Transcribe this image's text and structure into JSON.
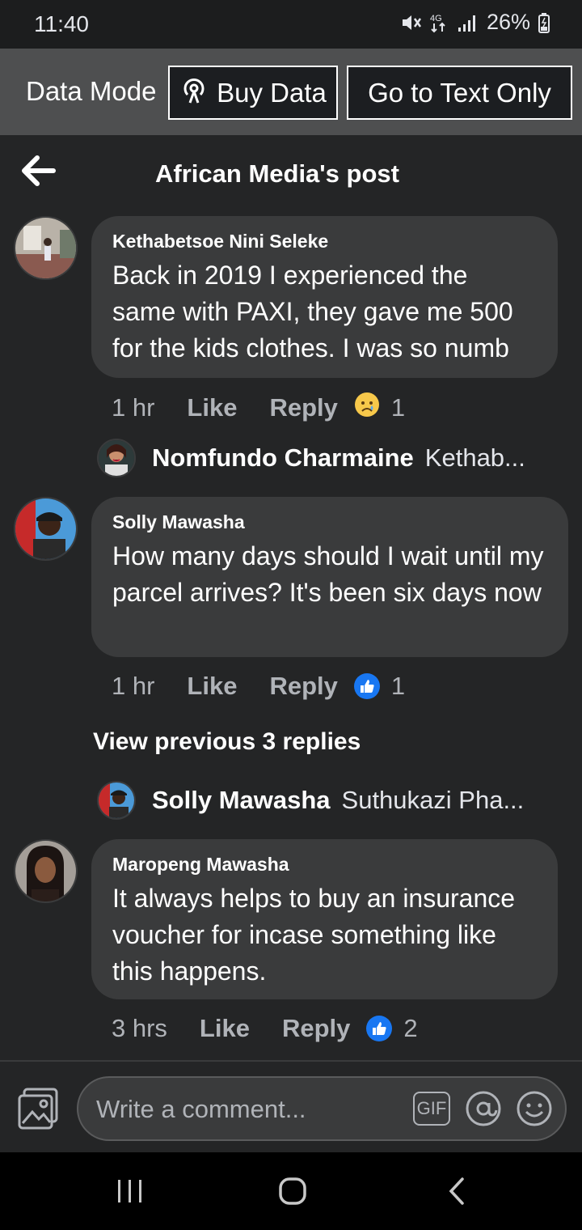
{
  "status_bar": {
    "time": "11:40",
    "network": "4G",
    "battery": "26%"
  },
  "data_mode": {
    "label": "Data Mode",
    "buy_data_label": "Buy Data",
    "text_only_label": "Go to Text Only"
  },
  "header": {
    "title": "African Media's post"
  },
  "comments": [
    {
      "author": "Kethabetsoe Nini Seleke",
      "text": "Back in 2019 I experienced the same with PAXI, they gave me 500 for the kids clothes. I was so numb",
      "time": "1 hr",
      "like_label": "Like",
      "reply_label": "Reply",
      "reaction": "sad-emoji",
      "reaction_count": "1",
      "reply_preview": {
        "name": "Nomfundo Charmaine",
        "text": "Kethab..."
      }
    },
    {
      "author": "Solly Mawasha",
      "text": "How many days should I wait until my parcel arrives? It's been six days now",
      "time": "1 hr",
      "like_label": "Like",
      "reply_label": "Reply",
      "reaction": "like-thumb",
      "reaction_count": "1",
      "view_previous": "View previous 3 replies",
      "reply_preview": {
        "name": "Solly Mawasha",
        "text": "Suthukazi Pha..."
      }
    },
    {
      "author": "Maropeng Mawasha",
      "text": "It always helps to buy an insurance voucher for incase something like this happens.",
      "time": "3 hrs",
      "like_label": "Like",
      "reply_label": "Reply",
      "reaction": "like-thumb",
      "reaction_count": "2"
    }
  ],
  "composer": {
    "placeholder": "Write a comment...",
    "gif_label": "GIF"
  },
  "colors": {
    "background": "#242526",
    "bubble": "#3a3b3c",
    "like_blue": "#1877f2",
    "data_bar": "#4e4f50"
  }
}
